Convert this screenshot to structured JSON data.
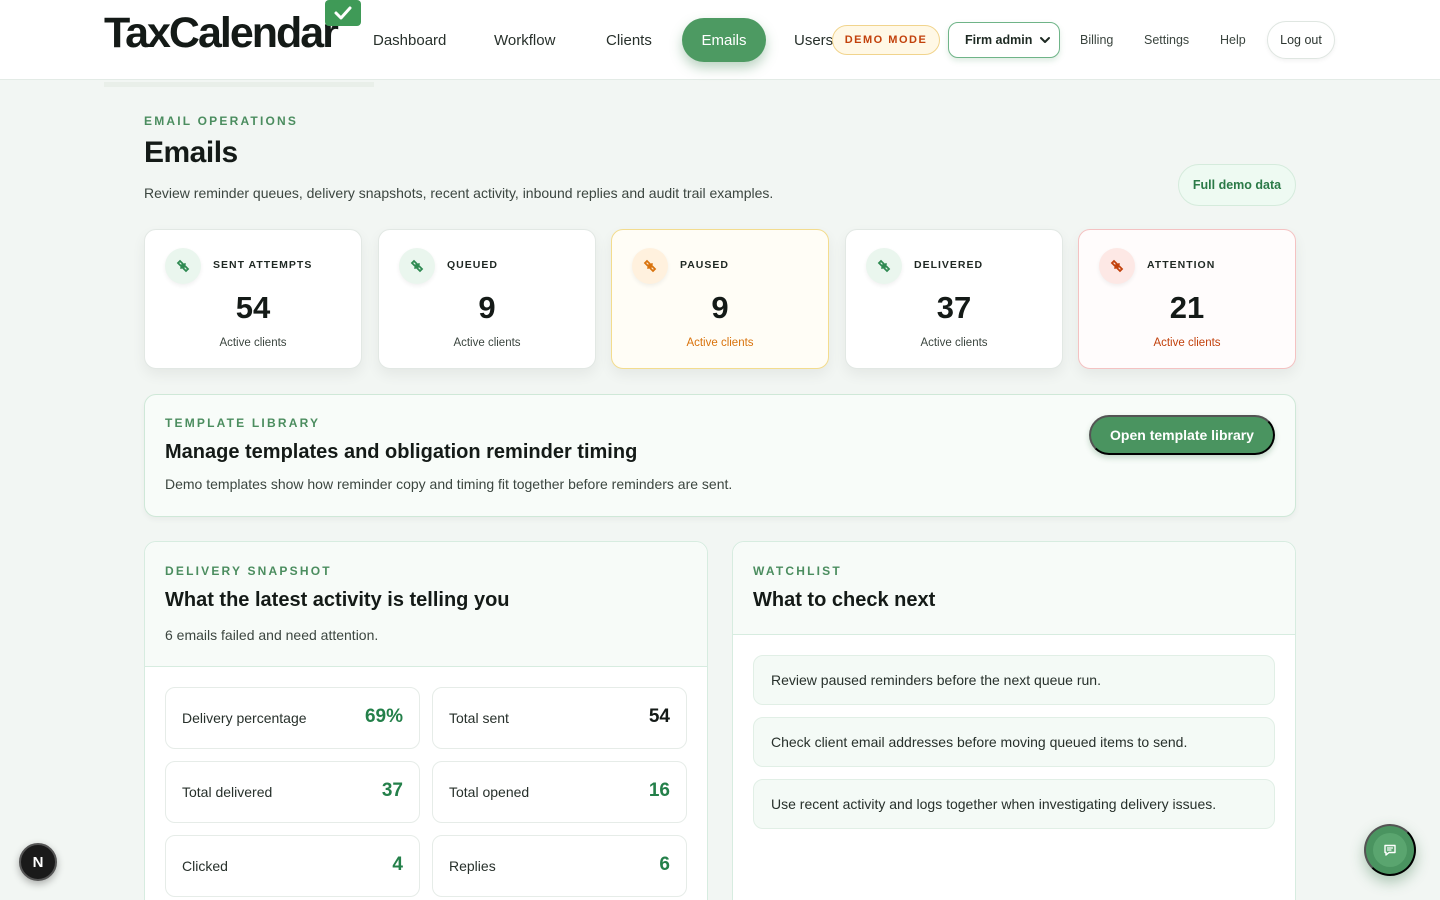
{
  "app": {
    "brand": "TaxCalendar"
  },
  "nav": {
    "items": [
      {
        "label": "Dashboard"
      },
      {
        "label": "Workflow"
      },
      {
        "label": "Clients"
      },
      {
        "label": "Emails"
      },
      {
        "label": "Users"
      }
    ],
    "demo_badge": "DEMO MODE",
    "role_select": "Firm admin",
    "billing": "Billing",
    "settings": "Settings",
    "help": "Help",
    "logout": "Log out"
  },
  "header": {
    "eyebrow": "EMAIL OPERATIONS",
    "title": "Emails",
    "subtitle": "Review reminder queues, delivery snapshots, recent activity, inbound replies and audit trail examples.",
    "demo_data_button": "Full demo data"
  },
  "stats": [
    {
      "label": "SENT ATTEMPTS",
      "value": "54",
      "sub": "Active clients",
      "tone": "normal"
    },
    {
      "label": "QUEUED",
      "value": "9",
      "sub": "Active clients",
      "tone": "normal"
    },
    {
      "label": "PAUSED",
      "value": "9",
      "sub": "Active clients",
      "tone": "warn"
    },
    {
      "label": "DELIVERED",
      "value": "37",
      "sub": "Active clients",
      "tone": "normal"
    },
    {
      "label": "ATTENTION",
      "value": "21",
      "sub": "Active clients",
      "tone": "danger"
    }
  ],
  "template_library": {
    "eyebrow": "TEMPLATE LIBRARY",
    "title": "Manage templates and obligation reminder timing",
    "description": "Demo templates show how reminder copy and timing fit together before reminders are sent.",
    "button": "Open template library"
  },
  "delivery_snapshot": {
    "eyebrow": "DELIVERY SNAPSHOT",
    "title": "What the latest activity is telling you",
    "description": "6 emails failed and need attention.",
    "metrics": [
      {
        "label": "Delivery percentage",
        "value": "69%"
      },
      {
        "label": "Total sent",
        "value": "54"
      },
      {
        "label": "Total delivered",
        "value": "37"
      },
      {
        "label": "Total opened",
        "value": "16"
      },
      {
        "label": "Clicked",
        "value": "4"
      },
      {
        "label": "Replies",
        "value": "6"
      }
    ]
  },
  "watchlist": {
    "eyebrow": "WATCHLIST",
    "title": "What to check next",
    "items": [
      "Review paused reminders before the next queue run.",
      "Check client email addresses before moving queued items to send.",
      "Use recent activity and logs together when investigating delivery issues."
    ]
  },
  "floating": {
    "n_badge": "N"
  },
  "colors": {
    "accent": "#4a9460",
    "accent_text": "#24804a",
    "warn": "#d9730d",
    "danger": "#c2410c",
    "background": "#f2f6f3"
  }
}
